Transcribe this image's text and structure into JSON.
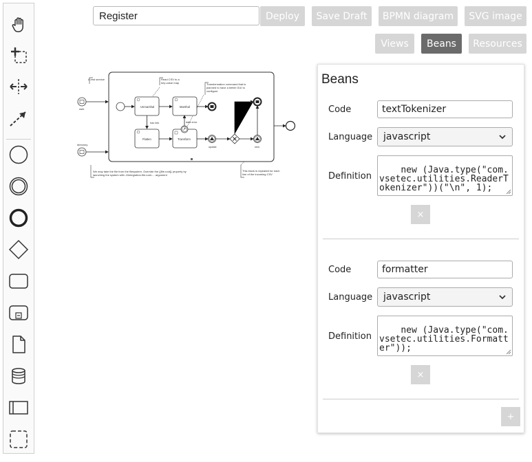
{
  "palette": {
    "tools": [
      {
        "name": "hand-tool-icon"
      },
      {
        "name": "lasso-tool-icon"
      },
      {
        "name": "space-tool-icon"
      },
      {
        "name": "connect-tool-icon"
      },
      {
        "name": "start-event-icon"
      },
      {
        "name": "intermediate-event-icon"
      },
      {
        "name": "end-event-icon"
      },
      {
        "name": "gateway-icon"
      },
      {
        "name": "task-icon"
      },
      {
        "name": "subprocess-icon"
      },
      {
        "name": "data-object-icon"
      },
      {
        "name": "data-store-icon"
      },
      {
        "name": "pool-icon"
      },
      {
        "name": "group-icon"
      }
    ]
  },
  "toolbar": {
    "process_name": "Register",
    "deploy_label": "Deploy",
    "save_draft_label": "Save Draft",
    "bpmn_label": "BPMN diagram",
    "svg_label": "SVG image",
    "views_label": "Views",
    "beans_label": "Beans",
    "resources_label": "Resources"
  },
  "diagram": {
    "annotation_rest": "A rest service",
    "annotation_read": [
      "Read CSV to a",
      "key-value map"
    ],
    "annotation_transform": [
      "Transformation command that is",
      "planned to have a better GUI to",
      "configure"
    ],
    "annotation_take": [
      "We may take the file from the filesystem. Override the {{file.root}} property by",
      "launching the system with -Dintegration.file.root=... argument"
    ],
    "annotation_block": [
      "This block is repeated for each",
      "line of the incoming CSV"
    ],
    "task_unmarshal": "Unmarshal",
    "task_marshal": "Marshal",
    "task_flatten": "Flatten",
    "task_transform": "Transform",
    "label_web": "web",
    "label_directory": "directory",
    "label_has_info": "has info",
    "label_data_error": "data error",
    "label_update": "update",
    "label_new": "new"
  },
  "beans": {
    "title": "Beans",
    "code_label": "Code",
    "language_label": "Language",
    "definition_label": "Definition",
    "remove_label": "×",
    "add_label": "+",
    "items": [
      {
        "code": "textTokenizer",
        "language": "javascript",
        "definition": "new (Java.type(\"com.vsetec.utilities.ReaderTokenizer\"))(\"\\n\", 1);"
      },
      {
        "code": "formatter",
        "language": "javascript",
        "definition": "new (Java.type(\"com.vsetec.utilities.Formatter\"));"
      }
    ]
  }
}
